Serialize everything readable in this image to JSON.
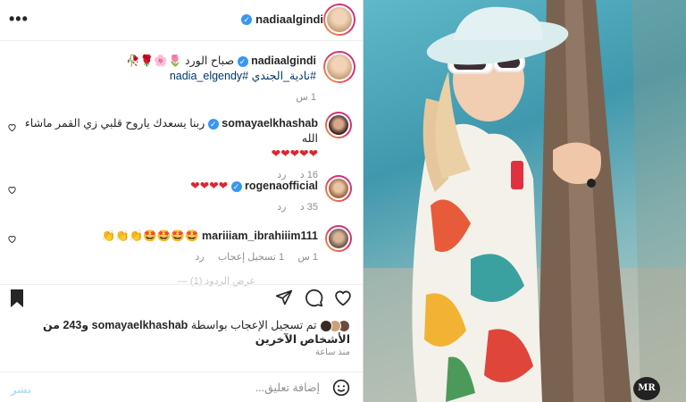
{
  "header": {
    "username": "nadiaalgindi",
    "more": "•••"
  },
  "caption": {
    "username": "nadiaalgindi",
    "text": "صباح الورد 🌷🌸🌹🥀",
    "hashtags": "#نادية_الجندي #nadia_elgendy",
    "time": "1 س"
  },
  "comments": [
    {
      "username": "somayaelkhashab",
      "text": "ربنا يسعدك ياروح قلبي زي القمر ماشاء الله",
      "text2": "❤❤❤❤❤",
      "time": "16 د",
      "reply": "رد"
    },
    {
      "username": "rogenaofficial",
      "text": "❤❤❤❤",
      "time": "35 د",
      "reply": "رد"
    },
    {
      "username": "mariiiam_ibrahiiim111",
      "text": "🤩🤩🤩🤩👏👏👏",
      "time": "1 س",
      "likes": "1 تسجيل إعجاب",
      "reply": "رد"
    }
  ],
  "hidden_replies": "— عرض الردود (1)",
  "likes_line": {
    "prefix": "تم تسجيل الإعجاب بواسطة",
    "user": "somayaelkhashab",
    "rest": "و243 من الأشخاص الآخرين"
  },
  "timestamp": "منذ ساعة",
  "composer": {
    "placeholder": "إضافة تعليق...",
    "post": "نشر"
  },
  "watermark": "MR",
  "colors": {
    "verified": "#3897f0",
    "link": "#00376b",
    "post_disabled": "#b2dffc"
  }
}
